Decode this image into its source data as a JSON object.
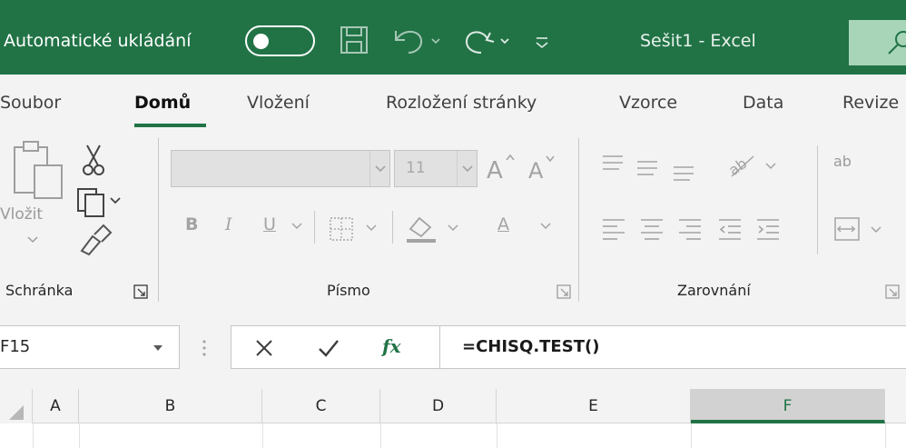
{
  "titlebar": {
    "autosave_label": "Automatické ukládání",
    "document_title": "Sešit1  -  Excel",
    "accent": "#217346"
  },
  "tabs": [
    {
      "label": "Soubor"
    },
    {
      "label": "Domů"
    },
    {
      "label": "Vložení"
    },
    {
      "label": "Rozložení stránky"
    },
    {
      "label": "Vzorce"
    },
    {
      "label": "Data"
    },
    {
      "label": "Revize"
    }
  ],
  "ribbon": {
    "clipboard": {
      "paste_label": "Vložit",
      "group_label": "Schránka"
    },
    "font": {
      "size_value": "11",
      "group_label": "Písmo",
      "bold": "B",
      "italic": "I",
      "underline": "U",
      "color_letter": "A"
    },
    "alignment": {
      "group_label": "Zarovnání",
      "wrap_label": "ab"
    }
  },
  "formula_bar": {
    "namebox_value": "F15",
    "formula": "=CHISQ.TEST()",
    "fx_label": "fx"
  },
  "columns": [
    "A",
    "B",
    "C",
    "D",
    "E",
    "F"
  ],
  "selected_column": "F"
}
